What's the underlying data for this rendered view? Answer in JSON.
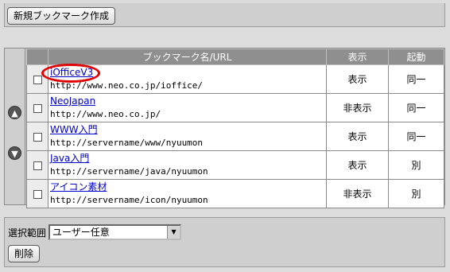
{
  "toolbar": {
    "new_bookmark_label": "新規ブックマーク作成"
  },
  "table": {
    "headers": {
      "name_url": "ブックマーク名/URL",
      "display": "表示",
      "launch": "起動"
    },
    "rows": [
      {
        "name": "iOfficeV3",
        "url": "http://www.neo.co.jp/ioffice/",
        "display": "表示",
        "launch": "同一",
        "checked": false
      },
      {
        "name": "NeoJapan",
        "url": "http://www.neo.co.jp/",
        "display": "非表示",
        "launch": "同一",
        "checked": false
      },
      {
        "name": "WWW入門",
        "url": "http://servername/www/nyuumon",
        "display": "表示",
        "launch": "同一",
        "checked": false
      },
      {
        "name": "Java入門",
        "url": "http://servername/java/nyuumon",
        "display": "表示",
        "launch": "別",
        "checked": false
      },
      {
        "name": "アイコン素材",
        "url": "http://servername/icon/nyuumon",
        "display": "非表示",
        "launch": "別",
        "checked": false
      }
    ]
  },
  "icons": {
    "move_up": "up-arrow-icon",
    "move_down": "down-arrow-icon"
  },
  "filter": {
    "label": "選択範囲",
    "selected": "ユーザー任意"
  },
  "actions": {
    "delete_label": "削除"
  },
  "colors": {
    "link": "#0000cc",
    "header_bg": "#8f8f8f",
    "highlight": "#e00000"
  }
}
